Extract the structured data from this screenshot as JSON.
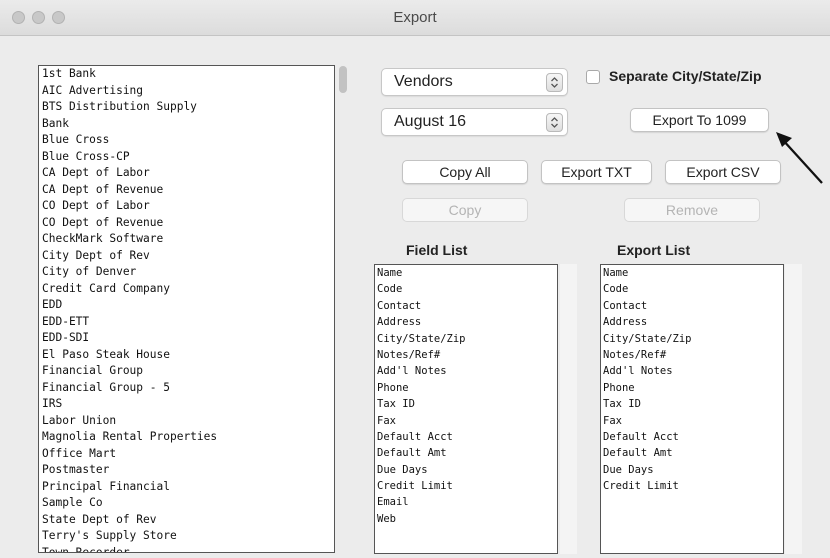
{
  "window": {
    "title": "Export"
  },
  "accounts": [
    "1st Bank",
    "AIC Advertising",
    "BTS Distribution Supply",
    "Bank",
    "Blue Cross",
    "Blue Cross-CP",
    "CA Dept of Labor",
    "CA Dept of Revenue",
    "CO Dept of Labor",
    "CO Dept of Revenue",
    "CheckMark Software",
    "City Dept of Rev",
    "City of Denver",
    "Credit Card Company",
    "EDD",
    "EDD-ETT",
    "EDD-SDI",
    "El Paso Steak House",
    "Financial Group",
    "Financial Group - 5",
    "IRS",
    "Labor Union",
    "Magnolia Rental Properties",
    "Office Mart",
    "Postmaster",
    "Principal Financial",
    "Sample Co",
    "State Dept of Rev",
    "Terry's Supply Store",
    "Town Recorder"
  ],
  "controls": {
    "type_popup": "Vendors",
    "date_popup": "August 16",
    "separate_checkbox": "Separate City/State/Zip",
    "export_1099": "Export To 1099",
    "copy_all": "Copy All",
    "export_txt": "Export TXT",
    "export_csv": "Export CSV",
    "copy": "Copy",
    "remove": "Remove"
  },
  "field_list": {
    "heading": "Field List",
    "items": [
      "Name",
      "Code",
      "Contact",
      "Address",
      "City/State/Zip",
      "Notes/Ref#",
      "Add'l Notes",
      "Phone",
      "Tax ID",
      "Fax",
      "Default Acct",
      "Default Amt",
      "Due Days",
      "Credit Limit",
      "Email",
      "Web"
    ]
  },
  "export_list": {
    "heading": "Export List",
    "items": [
      "Name",
      "Code",
      "Contact",
      "Address",
      "City/State/Zip",
      "Notes/Ref#",
      "Add'l Notes",
      "Phone",
      "Tax ID",
      "Fax",
      "Default Acct",
      "Default Amt",
      "Due Days",
      "Credit Limit"
    ]
  },
  "icons": {
    "arrow": "arrow-pointer-icon",
    "stepper": "up-down-chevron-icon"
  }
}
